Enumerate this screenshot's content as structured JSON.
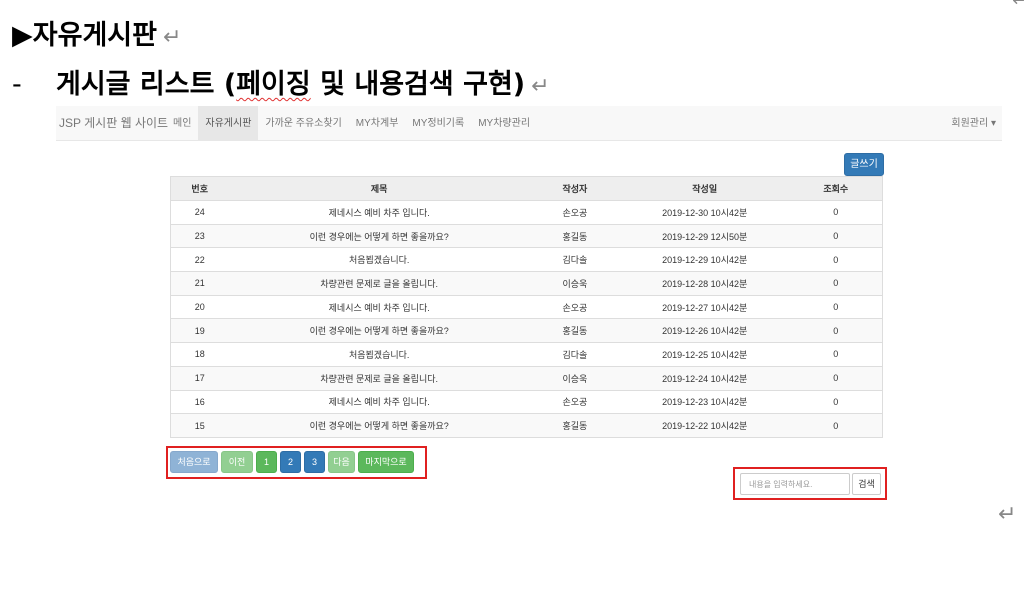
{
  "doc": {
    "heading1": "▶자유게시판",
    "heading2_dash": "-",
    "heading2_a": "게시글 리스트 (",
    "heading2_b": "페이징",
    "heading2_c": " 및 내용검색 구현)",
    "return_mark": "↵"
  },
  "navbar": {
    "brand": "JSP 게시판 웹 사이트",
    "items": [
      {
        "label": "메인",
        "active": false
      },
      {
        "label": "자유게시판",
        "active": true
      },
      {
        "label": "가까운 주유소찾기",
        "active": false
      },
      {
        "label": "MY차계부",
        "active": false
      },
      {
        "label": "MY정비기록",
        "active": false
      },
      {
        "label": "MY차량관리",
        "active": false
      }
    ],
    "right": "회원관리 ▾"
  },
  "write_button": "글쓰기",
  "table": {
    "headers": [
      "번호",
      "제목",
      "작성자",
      "작성일",
      "조회수"
    ],
    "rows": [
      [
        "24",
        "제네시스 예비 차주 입니다.",
        "손오공",
        "2019-12-30 10시42분",
        "0"
      ],
      [
        "23",
        "이런 경우에는 어떻게 하면 좋을까요?",
        "홍길동",
        "2019-12-29 12시50분",
        "0"
      ],
      [
        "22",
        "처음뵙겠습니다.",
        "김다솔",
        "2019-12-29 10시42분",
        "0"
      ],
      [
        "21",
        "차량관련 문제로 글을 올립니다.",
        "이승욱",
        "2019-12-28 10시42분",
        "0"
      ],
      [
        "20",
        "제네시스 예비 차주 입니다.",
        "손오공",
        "2019-12-27 10시42분",
        "0"
      ],
      [
        "19",
        "이런 경우에는 어떻게 하면 좋을까요?",
        "홍길동",
        "2019-12-26 10시42분",
        "0"
      ],
      [
        "18",
        "처음뵙겠습니다.",
        "김다솔",
        "2019-12-25 10시42분",
        "0"
      ],
      [
        "17",
        "차량관련 문제로 글을 올립니다.",
        "이승욱",
        "2019-12-24 10시42분",
        "0"
      ],
      [
        "16",
        "제네시스 예비 차주 입니다.",
        "손오공",
        "2019-12-23 10시42분",
        "0"
      ],
      [
        "15",
        "이런 경우에는 어떻게 하면 좋을까요?",
        "홍길동",
        "2019-12-22 10시42분",
        "0"
      ]
    ]
  },
  "pagination": {
    "first": "처음으로",
    "prev": "이전",
    "pages": [
      "1",
      "2",
      "3"
    ],
    "next": "다음",
    "last": "마지막으로"
  },
  "search": {
    "placeholder": "내용을 입력하세요.",
    "button": "검색"
  }
}
